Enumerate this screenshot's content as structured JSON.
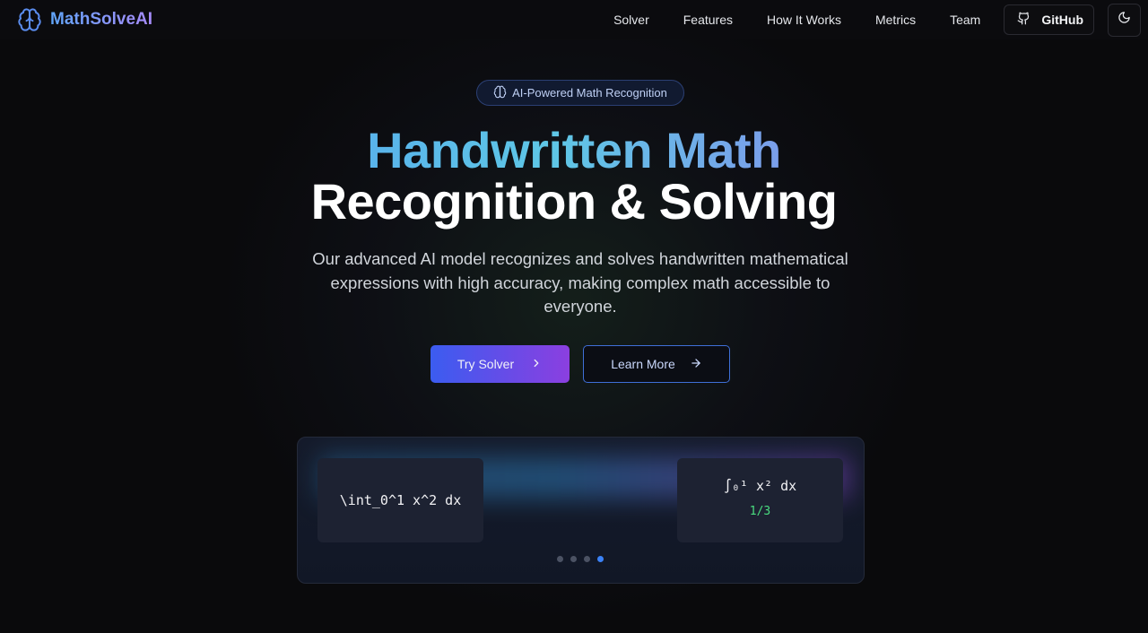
{
  "brand": {
    "name": "MathSolveAI",
    "icon": "brain-icon"
  },
  "nav": {
    "links": [
      "Solver",
      "Features",
      "How It Works",
      "Metrics",
      "Team"
    ],
    "github_label": "GitHub",
    "github_icon": "github-icon",
    "theme_icon": "moon-icon"
  },
  "hero": {
    "badge": "AI-Powered Math Recognition",
    "badge_icon": "brain-icon",
    "title_line1": "Handwritten Math",
    "title_line2": "Recognition & Solving",
    "subtitle": "Our advanced AI model recognizes and solves handwritten mathematical expressions with high accuracy, making complex math accessible to everyone.",
    "primary_button": "Try Solver",
    "primary_icon": "chevron-right-icon",
    "secondary_button": "Learn More",
    "secondary_icon": "arrow-right-icon"
  },
  "demo": {
    "input_latex": "\\int_0^1 x^2 dx",
    "rendered_expression": "∫₀¹ x² dx",
    "result": "1/3",
    "slide_count": 4,
    "active_slide": 4
  },
  "colors": {
    "accent_blue": "#3b82f6",
    "accent_purple": "#8b3fe0",
    "result_green": "#4ade80",
    "background": "#0a0a0c"
  }
}
